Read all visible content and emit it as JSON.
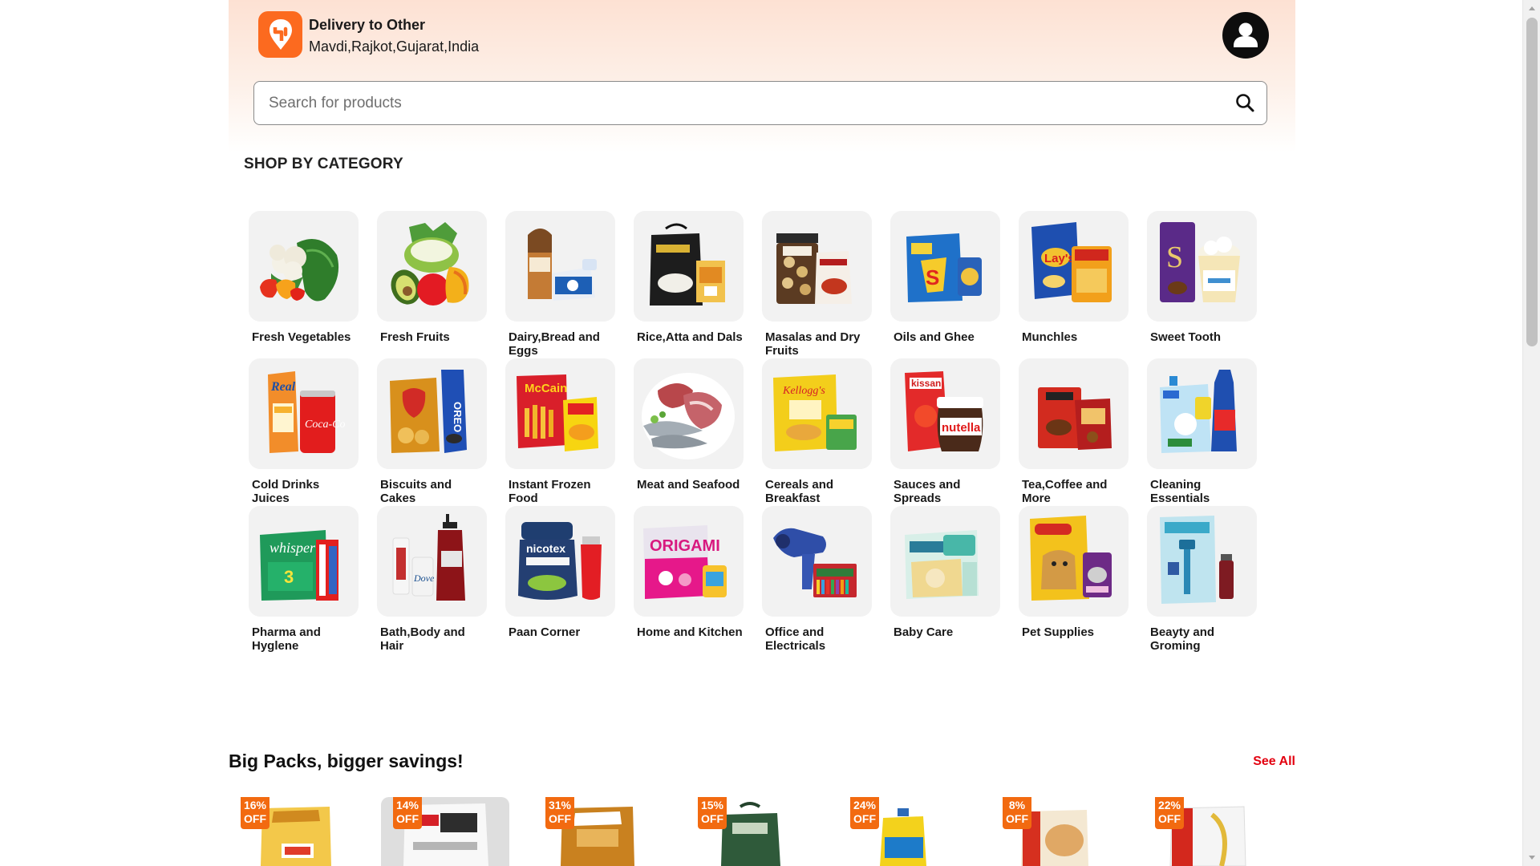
{
  "header": {
    "delivery_title": "Delivery to Other",
    "delivery_address": "Mavdi,Rajkot,Gujarat,India"
  },
  "search": {
    "placeholder": "Search for products"
  },
  "categories_section": {
    "title": "SHOP BY CATEGORY",
    "items": [
      {
        "label": "Fresh Vegetables"
      },
      {
        "label": "Fresh Fruits"
      },
      {
        "label": "Dairy,Bread and Eggs"
      },
      {
        "label": "Rice,Atta and Dals"
      },
      {
        "label": "Masalas and Dry Fruits"
      },
      {
        "label": "Oils and Ghee"
      },
      {
        "label": "Munchles"
      },
      {
        "label": "Sweet Tooth"
      },
      {
        "label": "Cold Drinks Juices"
      },
      {
        "label": "Biscuits and Cakes"
      },
      {
        "label": "Instant Frozen Food"
      },
      {
        "label": "Meat and Seafood"
      },
      {
        "label": "Cereals and Breakfast"
      },
      {
        "label": "Sauces and Spreads"
      },
      {
        "label": "Tea,Coffee and More"
      },
      {
        "label": "Cleaning Essentials"
      },
      {
        "label": "Pharma and Hyglene"
      },
      {
        "label": "Bath,Body and Hair"
      },
      {
        "label": "Paan Corner"
      },
      {
        "label": "Home and Kitchen"
      },
      {
        "label": "Office and Electricals"
      },
      {
        "label": "Baby Care"
      },
      {
        "label": "Pet Supplies"
      },
      {
        "label": "Beayty and Groming"
      }
    ]
  },
  "big_packs": {
    "title": "Big Packs, bigger savings!",
    "see_all": "See All",
    "products": [
      {
        "discount": "16%",
        "off": "OFF"
      },
      {
        "discount": "14%",
        "off": "OFF"
      },
      {
        "discount": "31%",
        "off": "OFF"
      },
      {
        "discount": "15%",
        "off": "OFF"
      },
      {
        "discount": "24%",
        "off": "OFF"
      },
      {
        "discount": "8%",
        "off": "OFF"
      },
      {
        "discount": "22%",
        "off": "OFF"
      }
    ]
  },
  "colors": {
    "brand_orange": "#fc6a1f",
    "see_all_red": "#e3000f",
    "badge_orange": "#f26a10"
  }
}
